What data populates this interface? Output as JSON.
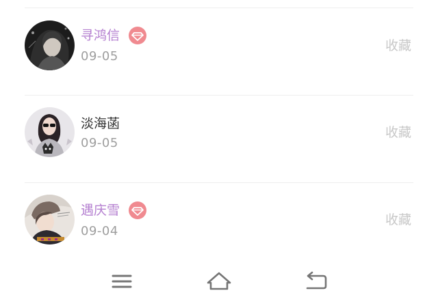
{
  "list": {
    "items": [
      {
        "name": "寻鸿信",
        "date": "09-05",
        "vip": true,
        "action_label": "收藏",
        "avatar_icon": "user-avatar-dark-hair"
      },
      {
        "name": "淡海菡",
        "date": "09-05",
        "vip": false,
        "action_label": "收藏",
        "avatar_icon": "user-avatar-sunglasses-cat-shirt"
      },
      {
        "name": "遇庆雪",
        "date": "09-04",
        "vip": true,
        "action_label": "收藏",
        "avatar_icon": "user-avatar-hat-portrait"
      }
    ]
  },
  "navbar": {
    "menu_icon": "menu-icon",
    "home_icon": "home-icon",
    "back_icon": "back-icon"
  },
  "colors": {
    "vip_name": "#b47fd0",
    "normal_name": "#333333",
    "date": "#9e9e9e",
    "action": "#c8c8c8",
    "vip_badge": "#f08a90",
    "divider": "#eeeeee"
  }
}
